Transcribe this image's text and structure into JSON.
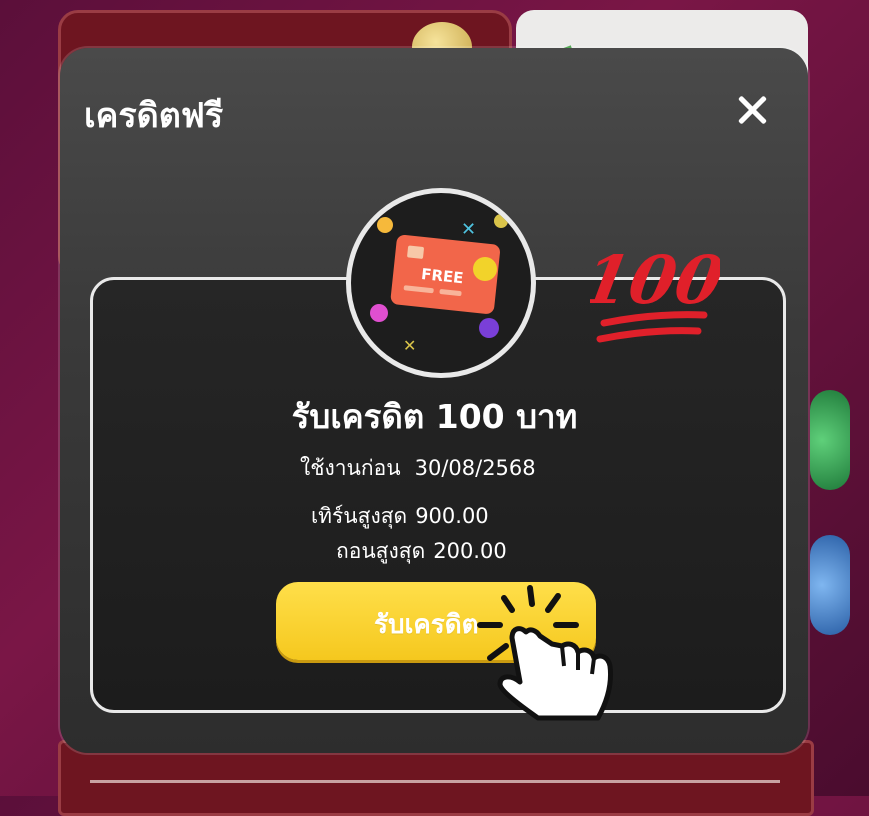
{
  "modal": {
    "title": "เครดิตฟรี",
    "card_badge": "FREE",
    "hundred_badge": "100",
    "headline": "รับเครดิต 100 บาท",
    "expiry_label": "ใช้งานก่อน",
    "expiry_date": "30/08/2568",
    "turnover_label": "เทิร์นสูงสุด",
    "turnover_value": "900.00",
    "withdraw_label": "ถอนสูงสุด",
    "withdraw_value": "200.00",
    "claim_button": "รับเครดิต"
  },
  "colors": {
    "button_yellow": "#f5c81e",
    "badge_red": "#e0202a",
    "card_orange": "#f2664a",
    "modal_bg": "#3a3a3a"
  },
  "icons": [
    "close-icon",
    "free-credit-card-icon",
    "hundred-points-icon",
    "pointing-hand-icon"
  ]
}
